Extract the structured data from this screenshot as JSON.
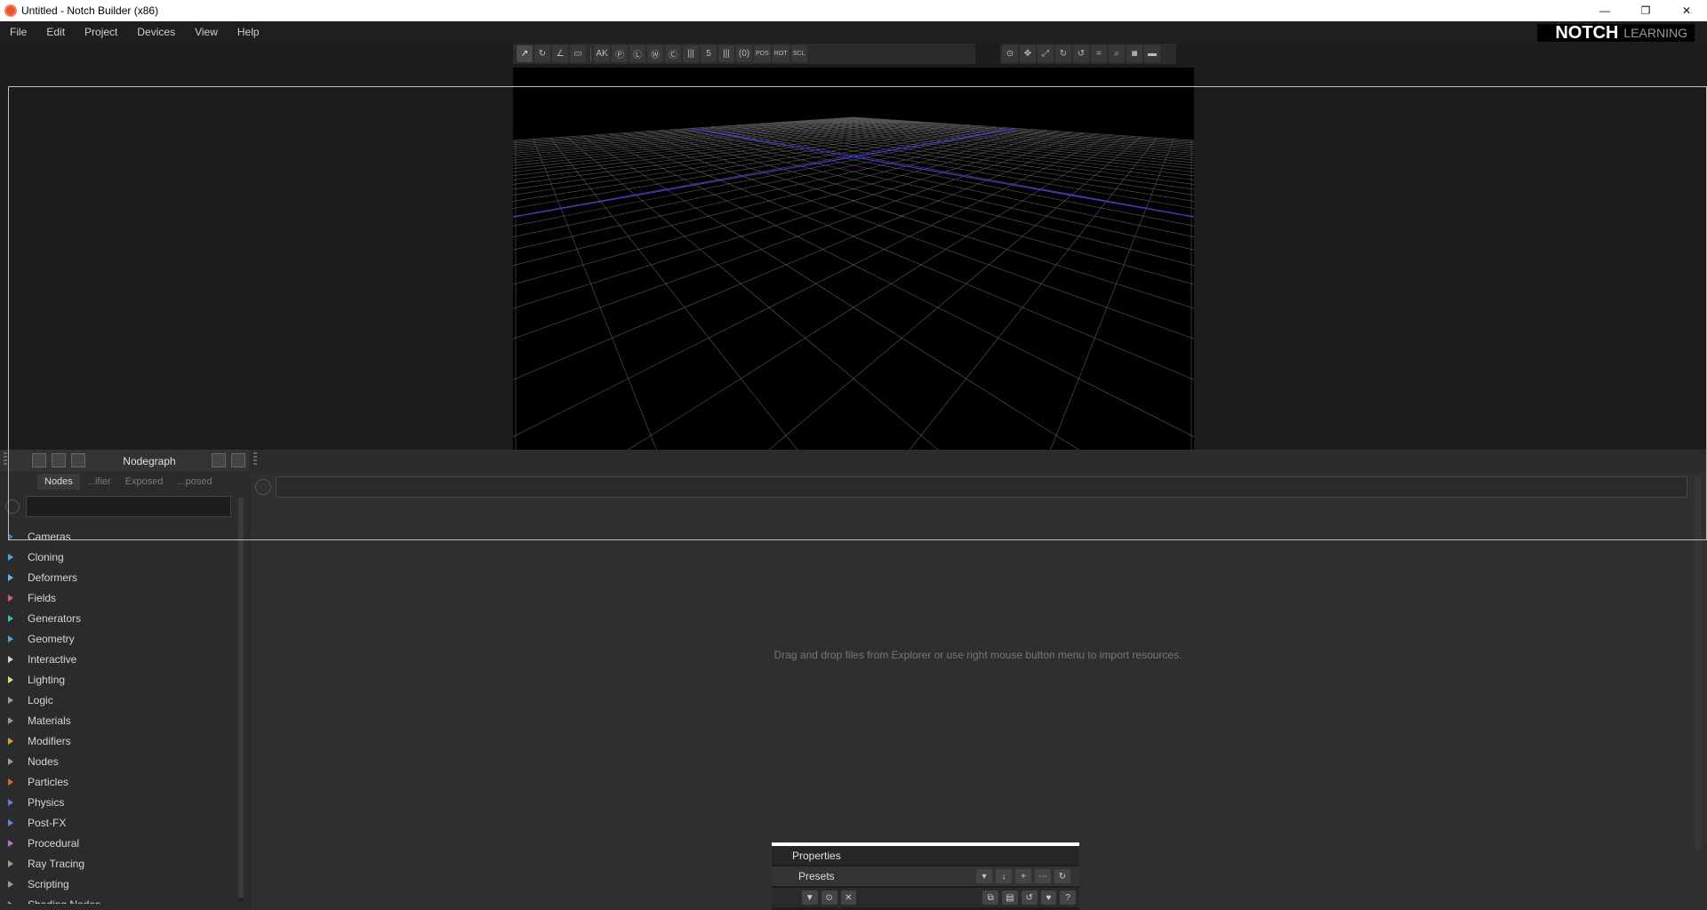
{
  "window": {
    "title": "Untitled - Notch Builder (x86)",
    "controls": {
      "minimize": "—",
      "restore": "❐",
      "close": "✕"
    }
  },
  "menu": {
    "items": [
      "File",
      "Edit",
      "Project",
      "Devices",
      "View",
      "Help"
    ]
  },
  "brand": {
    "name": "NOTCH",
    "suffix": "LEARNING"
  },
  "toolbar": {
    "counter": "5",
    "lock_labels": [
      "POS",
      "ROT",
      "SCL"
    ]
  },
  "nodegraph": {
    "title": "Nodegraph",
    "tabs": [
      "Nodes",
      "...ifier",
      "Exposed",
      "...posed"
    ],
    "empty_message": "Drag and drop files from Explorer or use right mouse button menu to import resources."
  },
  "node_categories": [
    {
      "label": "Cameras",
      "color": "#3a7bd5"
    },
    {
      "label": "Cloning",
      "color": "#4fa3e0"
    },
    {
      "label": "Deformers",
      "color": "#6db3f2"
    },
    {
      "label": "Fields",
      "color": "#e0529c"
    },
    {
      "label": "Generators",
      "color": "#3fb6b0"
    },
    {
      "label": "Geometry",
      "color": "#4aa8d8"
    },
    {
      "label": "Interactive",
      "color": "#cfd3d6"
    },
    {
      "label": "Lighting",
      "color": "#e8e07a"
    },
    {
      "label": "Logic",
      "color": "#9a9a9a"
    },
    {
      "label": "Materials",
      "color": "#9a9a9a"
    },
    {
      "label": "Modifiers",
      "color": "#e0a02a"
    },
    {
      "label": "Nodes",
      "color": "#9a9a9a"
    },
    {
      "label": "Particles",
      "color": "#e0663a"
    },
    {
      "label": "Physics",
      "color": "#6a78d8"
    },
    {
      "label": "Post-FX",
      "color": "#5a8ad8"
    },
    {
      "label": "Procedural",
      "color": "#c46ad8"
    },
    {
      "label": "Ray Tracing",
      "color": "#9a9a9a"
    },
    {
      "label": "Scripting",
      "color": "#9a9a9a"
    },
    {
      "label": "Shading Nodes",
      "color": "#9a9a9a"
    }
  ],
  "properties": {
    "title": "Properties",
    "presets_label": "Presets"
  }
}
